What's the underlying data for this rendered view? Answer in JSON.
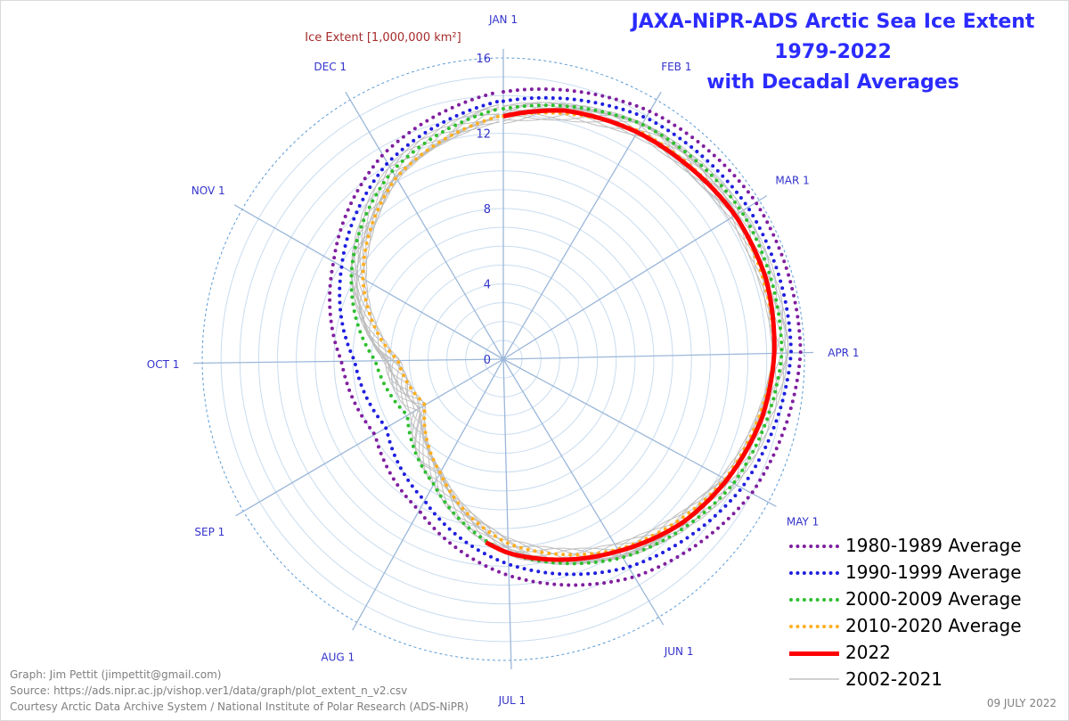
{
  "title": {
    "line1": "JAXA-NiPR-ADS Arctic Sea Ice Extent",
    "line2": "1979-2022",
    "line3": "with Decadal Averages"
  },
  "footer": {
    "graph": "Graph: Jim Pettit (jimpettit@gmail.com)",
    "source": "Source: https://ads.nipr.ac.jp/vishop.ver1/data/graph/plot_extent_n_v2.csv",
    "courtesy": "Courtesy Arctic Data Archive System / National Institute of Polar Research (ADS-NiPR)",
    "date": "09 JULY 2022"
  },
  "chart_data": {
    "type": "line",
    "subtype": "polar/radar",
    "radial_axis": {
      "label": "Ice Extent [1,000,000 km²]",
      "min": 0,
      "max": 16,
      "ticks": [
        0,
        4,
        8,
        12,
        16
      ]
    },
    "angular_axis": {
      "labels": [
        "JAN 1",
        "FEB 1",
        "MAR 1",
        "APR 1",
        "MAY 1",
        "JUN 1",
        "JUL 1",
        "AUG 1",
        "SEP 1",
        "OCT 1",
        "NOV 1",
        "DEC 1"
      ],
      "day_of_year": [
        1,
        32,
        60,
        91,
        121,
        152,
        182,
        213,
        244,
        274,
        305,
        335
      ],
      "direction": "clockwise from top"
    },
    "series": [
      {
        "name": "1980-1989 Average",
        "color": "#7f1f9f",
        "style": "dotted",
        "x": [
          1,
          32,
          60,
          91,
          121,
          152,
          182,
          213,
          244,
          274,
          305,
          335,
          365
        ],
        "values": [
          14.2,
          15.3,
          15.8,
          15.8,
          15.0,
          13.5,
          11.5,
          9.2,
          7.9,
          8.6,
          10.4,
          12.6,
          14.2
        ]
      },
      {
        "name": "1990-1999 Average",
        "color": "#1f1fdf",
        "style": "dotted",
        "x": [
          1,
          32,
          60,
          91,
          121,
          152,
          182,
          213,
          244,
          274,
          305,
          335,
          365
        ],
        "values": [
          13.7,
          14.9,
          15.3,
          15.3,
          14.4,
          12.9,
          10.9,
          8.6,
          7.2,
          7.9,
          9.9,
          12.1,
          13.7
        ]
      },
      {
        "name": "2000-2009 Average",
        "color": "#2fbf2f",
        "style": "dotted",
        "x": [
          1,
          32,
          60,
          91,
          121,
          152,
          182,
          213,
          244,
          274,
          305,
          335,
          365
        ],
        "values": [
          13.3,
          14.5,
          14.9,
          14.8,
          13.9,
          12.3,
          10.3,
          7.6,
          5.9,
          6.8,
          9.3,
          11.6,
          13.3
        ]
      },
      {
        "name": "2010-2020 Average",
        "color": "#ffaf1f",
        "style": "dotted",
        "x": [
          1,
          32,
          60,
          91,
          121,
          152,
          182,
          213,
          244,
          274,
          305,
          335,
          365
        ],
        "values": [
          12.9,
          14.1,
          14.5,
          14.4,
          13.4,
          11.8,
          9.8,
          6.9,
          4.8,
          5.6,
          8.6,
          11.2,
          12.9
        ]
      },
      {
        "name": "2022",
        "color": "#ff0000",
        "style": "solid",
        "x": [
          1,
          15,
          32,
          45,
          60,
          75,
          91,
          105,
          121,
          135,
          152,
          165,
          182,
          190
        ],
        "values": [
          12.9,
          13.6,
          14.0,
          14.2,
          14.5,
          14.6,
          14.4,
          14.1,
          13.5,
          12.9,
          11.9,
          11.2,
          10.3,
          9.7
        ]
      },
      {
        "name": "2002-2021",
        "color": "#bfbfbf",
        "style": "thin lines",
        "x": [
          1,
          32,
          60,
          91,
          121,
          152,
          182,
          213,
          244,
          274,
          305,
          335,
          365
        ],
        "values": [
          13.0,
          14.3,
          14.6,
          14.6,
          13.6,
          12.0,
          10.0,
          7.1,
          5.2,
          6.0,
          8.9,
          11.4,
          13.0
        ]
      }
    ],
    "grid": true,
    "legend_position": "bottom-right"
  }
}
